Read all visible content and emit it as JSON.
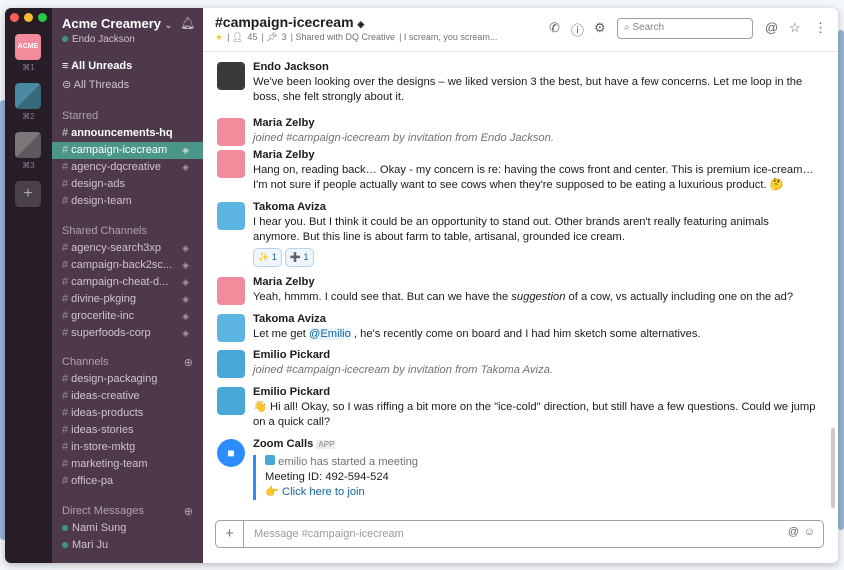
{
  "colors": {
    "sidebar": "#4d394b",
    "rail": "#261d26",
    "active": "#4c9689",
    "link": "#1264a3"
  },
  "rail": {
    "teams": [
      {
        "label": "⌘1",
        "name": "ACME"
      },
      {
        "label": "⌘2"
      },
      {
        "label": "⌘3"
      }
    ],
    "add": "+"
  },
  "sidebar": {
    "workspace": "Acme Creamery",
    "user": "Endo Jackson",
    "all_unreads": "All Unreads",
    "all_threads": "All Threads",
    "starred_title": "Starred",
    "starred": [
      "announcements-hq",
      "campaign-icecream",
      "agency-dqcreative",
      "design-ads",
      "design-team"
    ],
    "shared_title": "Shared Channels",
    "shared": [
      "agency-search3xp",
      "campaign-back2sc...",
      "campaign-cheat-d...",
      "divine-pkging",
      "grocerlite-inc",
      "superfoods-corp"
    ],
    "channels_title": "Channels",
    "channels": [
      "design-packaging",
      "ideas-creative",
      "ideas-products",
      "ideas-stories",
      "in-store-mktg",
      "marketing-team",
      "office-pa"
    ],
    "dm_title": "Direct Messages",
    "dms": [
      "Nami Sung",
      "Mari Ju"
    ]
  },
  "header": {
    "channel": "#campaign-icecream",
    "members": "45",
    "pins": "3",
    "shared": "Shared with DQ Creative",
    "topic": "I scream, you scream...",
    "search_placeholder": "Search"
  },
  "messages": [
    {
      "name": "Endo Jackson",
      "text": "We've been looking over the designs – we liked version 3 the best, but have a few concerns. Let me loop in the boss, she felt strongly about it."
    },
    {
      "name": "Maria Zelby",
      "text": "joined #campaign-icecream by invitation from Endo Jackson."
    },
    {
      "name": "Maria Zelby",
      "text": "Hang on, reading back… Okay - my concern is re: having the cows front and center. This is premium ice-cream… I'm not sure if people actually want to see cows when they're supposed to be eating a luxurious product. 🤔"
    },
    {
      "name": "Takoma Aviza",
      "text": "I hear you. But I think it could be an opportunity to stand out. Other brands aren't really featuring animals anymore. But this line is about farm to table, artisanal, grounded ice cream.",
      "reactions": [
        {
          "emoji": "✨",
          "count": "1"
        },
        {
          "emoji": "➕",
          "count": "1"
        }
      ]
    },
    {
      "name": "Maria Zelby",
      "pre": "Yeah, hmmm. I could see that. But can we have the ",
      "em": "suggestion",
      "post": " of a cow, vs actually including one on the ad?"
    },
    {
      "name": "Takoma Aviza",
      "pre": "Let me get ",
      "mention": "@Emilio",
      "post": " , he's recently come on board and I had him sketch some alternatives."
    },
    {
      "name": "Emilio Pickard",
      "text": "joined #campaign-icecream by invitation from Takoma Aviza."
    },
    {
      "name": "Emilio Pickard",
      "text": "👋 Hi all! Okay, so I was riffing a bit more on the \"ice-cold\" direction, but still have a few questions. Could we jump on a quick call?"
    },
    {
      "name": "Zoom Calls",
      "badge": "APP",
      "started": "emilio has started a meeting",
      "meeting": "Meeting ID: 492-594-524",
      "join": "Click here to join"
    }
  ],
  "composer": {
    "placeholder": "Message #campaign-icecream"
  }
}
